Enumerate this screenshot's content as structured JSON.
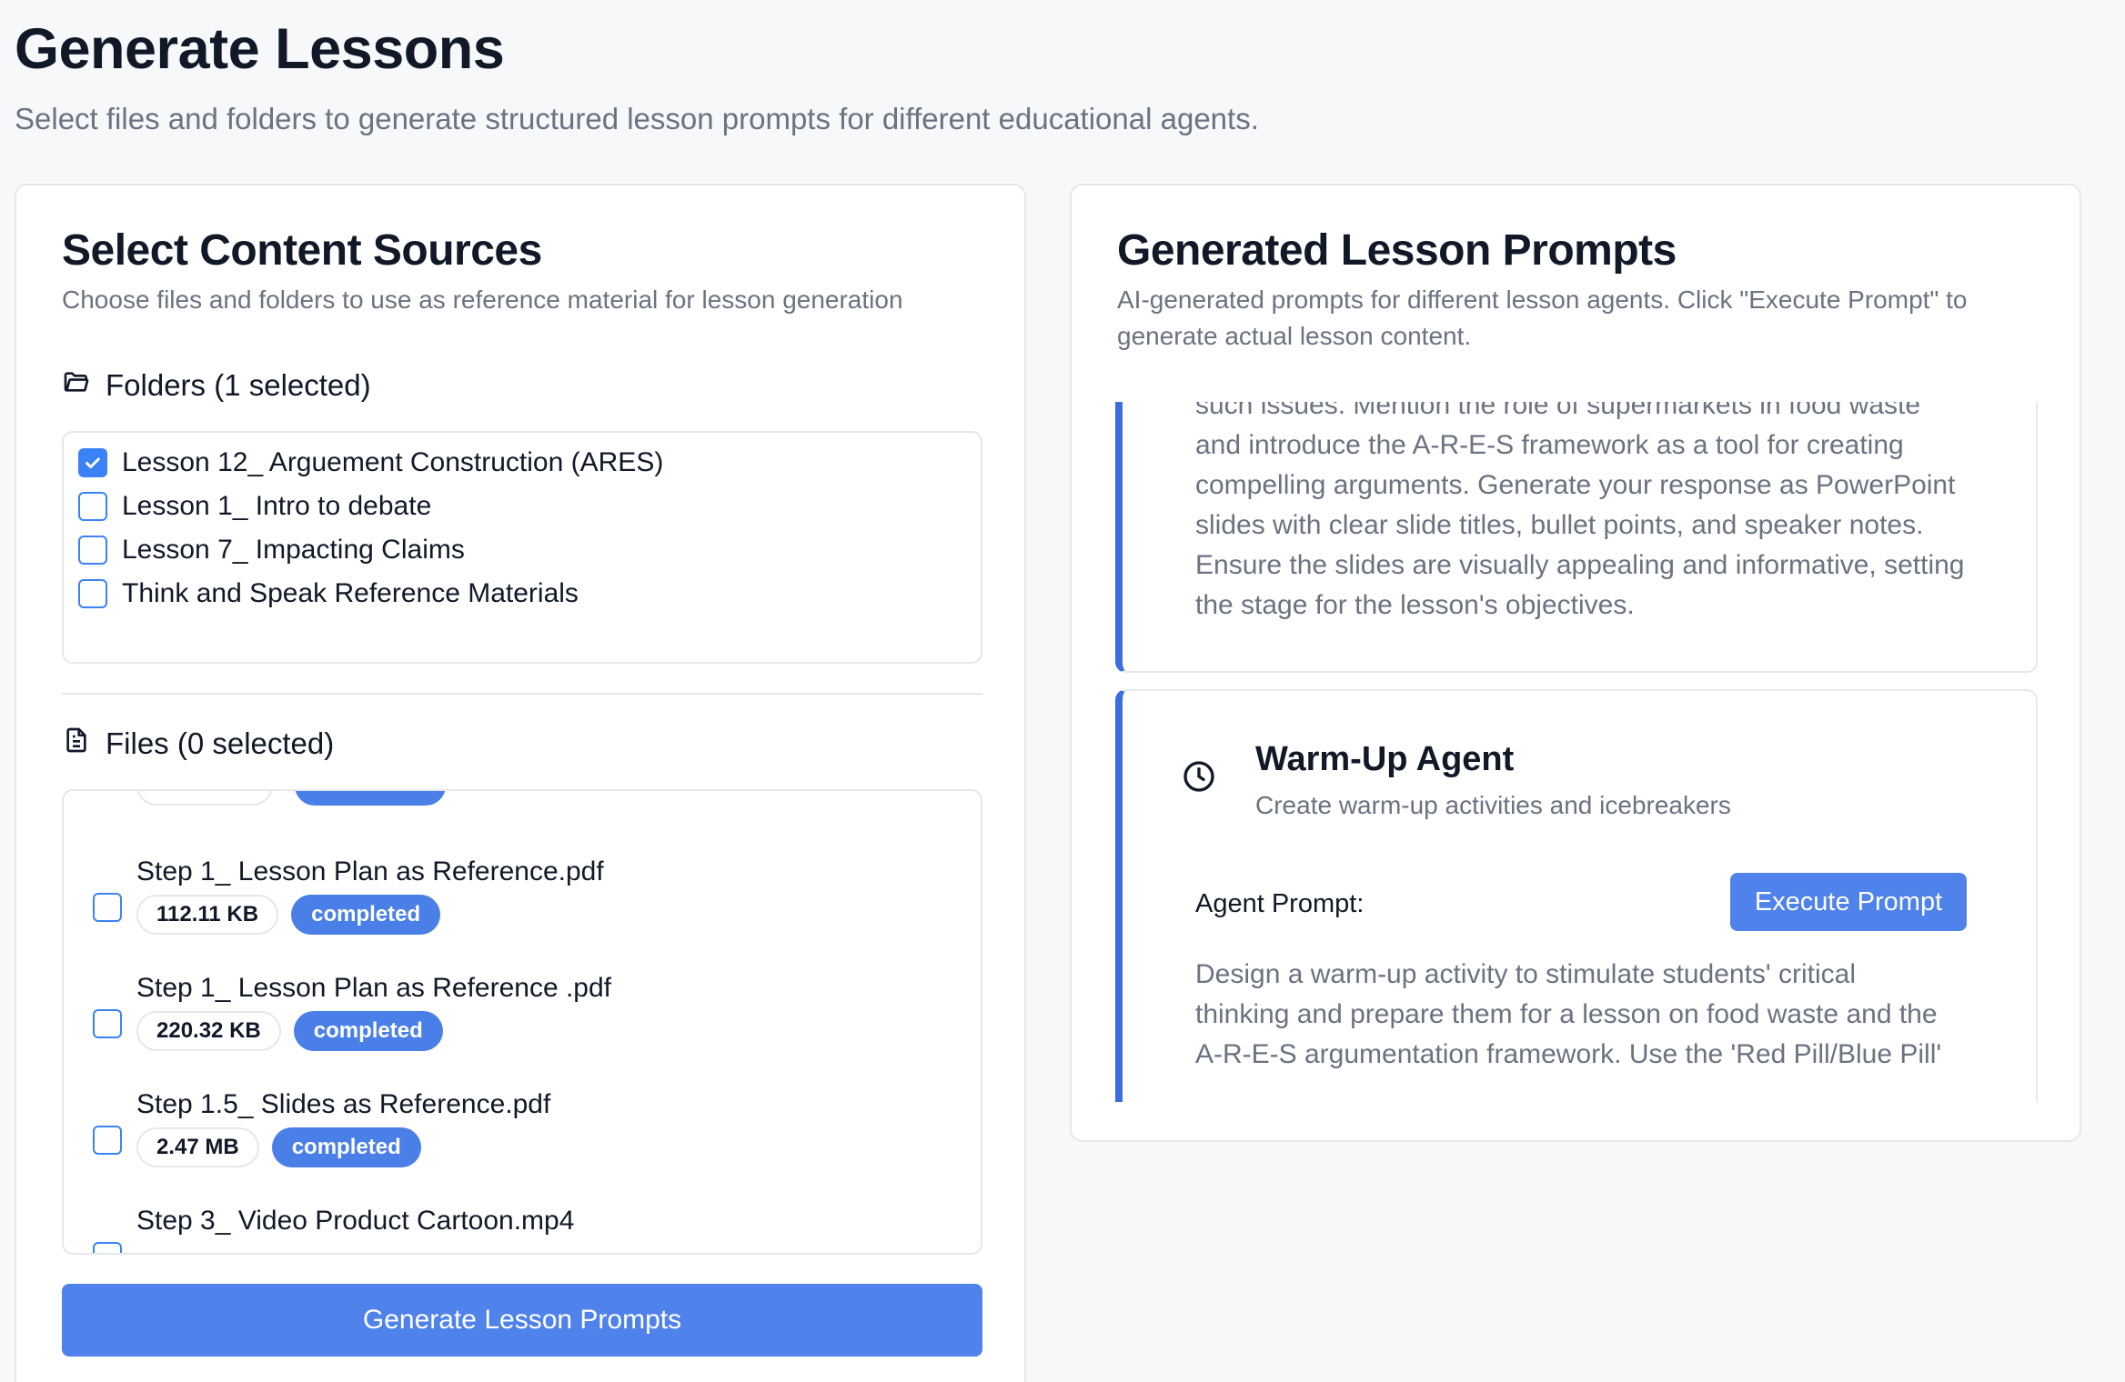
{
  "page": {
    "title": "Generate Lessons",
    "subtitle": "Select files and folders to generate structured lesson prompts for different educational agents."
  },
  "left": {
    "title": "Select Content Sources",
    "description": "Choose files and folders to use as reference material for lesson generation",
    "folders_heading": "Folders (1 selected)",
    "folders": [
      {
        "label": "Lesson 12_ Arguement Construction (ARES)",
        "checked": true
      },
      {
        "label": "Lesson 1_ Intro to debate",
        "checked": false
      },
      {
        "label": "Lesson 7_ Impacting Claims",
        "checked": false
      },
      {
        "label": "Think and Speak Reference Materials",
        "checked": false
      }
    ],
    "files_heading": "Files (0 selected)",
    "files": [
      {
        "name": "Step 1_ Lesson Plan as Reference.pdf",
        "size": "112.11 KB",
        "status": "completed"
      },
      {
        "name": "Step 1_ Lesson Plan as Reference .pdf",
        "size": "220.32 KB",
        "status": "completed"
      },
      {
        "name": "Step 1.5_ Slides as Reference.pdf",
        "size": "2.47 MB",
        "status": "completed"
      },
      {
        "name": "Step 3_ Video Product Cartoon.mp4",
        "size": "",
        "status": ""
      }
    ],
    "generate_button": "Generate Lesson Prompts"
  },
  "right": {
    "title": "Generated Lesson Prompts",
    "description": "AI-generated prompts for different lesson agents. Click \"Execute Prompt\" to generate actual lesson content.",
    "previous_prompt_lines": [
      "such issues. Mention the role of supermarkets in food waste",
      "and introduce the A-R-E-S framework as a tool for creating",
      "compelling arguments. Generate your response as PowerPoint",
      "slides with clear slide titles, bullet points, and speaker notes.",
      "Ensure the slides are visually appealing and informative, setting",
      "the stage for the lesson's objectives."
    ],
    "agent": {
      "name": "Warm-Up Agent",
      "subtitle": "Create warm-up activities and icebreakers",
      "prompt_label": "Agent Prompt:",
      "execute_button": "Execute Prompt",
      "prompt_lines": [
        "Design a warm-up activity to stimulate students' critical",
        "thinking and prepare them for a lesson on food waste and the",
        "A-R-E-S argumentation framework. Use the 'Red Pill/Blue Pill'"
      ]
    }
  },
  "colors": {
    "accent": "#4f82ea",
    "badge": "#4a7fe8",
    "agent_border": "#3b6fe0",
    "muted_text": "#6b7280"
  }
}
